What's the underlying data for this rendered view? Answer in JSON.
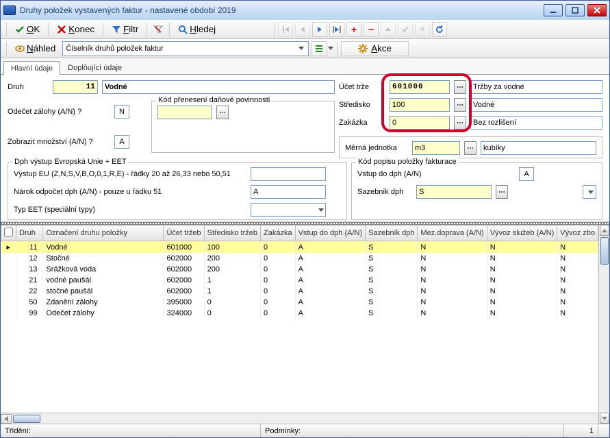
{
  "titlebar": {
    "title": "Druhy položek vystavených faktur - nastavené období 2019"
  },
  "toolbar1": {
    "ok": "OK",
    "konec": "Konec",
    "filtr": "Filtr",
    "hledej": "Hledej"
  },
  "toolbar2": {
    "nahled": "Náhled",
    "combo": "Číselník druhů položek faktur",
    "akce": "Akce"
  },
  "tabs": {
    "t1": "Hlavní údaje",
    "t2": "Doplňující údaje"
  },
  "form": {
    "druh_label": "Druh",
    "druh_code": "11",
    "druh_name": "Vodné",
    "odecet_label": "Odečet zálohy (A/N) ?",
    "odecet_val": "N",
    "zobrazit_label": "Zobrazit množství (A/N) ?",
    "zobrazit_val": "A",
    "kodpren_label": "Kód přenesení daňové povinnosti",
    "kodpren_val": "",
    "ucet_label": "Účet trže",
    "ucet_val": "601000",
    "ucet_desc": "Tržby za vodné",
    "stred_label": "Středisko",
    "stred_val": "100",
    "stred_desc": "Vodné",
    "zak_label": "Zakázka",
    "zak_val": "0",
    "zak_desc": "Bez rozlišení",
    "mj_label": "Měrná jednotka",
    "mj_val": "m3",
    "mj_desc": "kubíky",
    "eet_caption": "Dph výstup Evropská Unie + EET",
    "vystup_label": "Výstup EU (Z,N,S,V,B,O,0,1,R,E) - řádky 20 až 26,33 nebo 50,51",
    "vystup_val": "",
    "narok_label": "Nárok odpočet dph (A/N) - pouze u řádku 51",
    "narok_val": "A",
    "typeet_label": "Typ EET (speciální typy)",
    "typeet_val": "",
    "kodpop_caption": "Kód popisu položky fakturace",
    "vstup_label": "Vstup do dph (A/N)",
    "vstup_val": "A",
    "saz_label": "Sazebník dph",
    "saz_val": "S"
  },
  "grid": {
    "h0": "Druh",
    "h1": "Označení druhu položky",
    "h2": "Účet tržeb",
    "h3": "Středisko tržeb",
    "h4": "Zakázka",
    "h5": "Vstup do dph (A/N)",
    "h6": "Sazebník dph",
    "h7": "Mez.doprava (A/N)",
    "h8": "Vývoz služeb (A/N)",
    "h9": "Vývoz zbo",
    "rows": [
      {
        "c0": "11",
        "c1": "Vodné",
        "c2": "601000",
        "c3": "100",
        "c4": "0",
        "c5": "A",
        "c6": "S",
        "c7": "N",
        "c8": "N",
        "c9": "N"
      },
      {
        "c0": "12",
        "c1": "Stočné",
        "c2": "602000",
        "c3": "200",
        "c4": "0",
        "c5": "A",
        "c6": "S",
        "c7": "N",
        "c8": "N",
        "c9": "N"
      },
      {
        "c0": "13",
        "c1": "Srážková voda",
        "c2": "602000",
        "c3": "200",
        "c4": "0",
        "c5": "A",
        "c6": "S",
        "c7": "N",
        "c8": "N",
        "c9": "N"
      },
      {
        "c0": "21",
        "c1": "vodné paušál",
        "c2": "602000",
        "c3": "1",
        "c4": "0",
        "c5": "A",
        "c6": "S",
        "c7": "N",
        "c8": "N",
        "c9": "N"
      },
      {
        "c0": "22",
        "c1": "stočné paušál",
        "c2": "602000",
        "c3": "1",
        "c4": "0",
        "c5": "A",
        "c6": "S",
        "c7": "N",
        "c8": "N",
        "c9": "N"
      },
      {
        "c0": "50",
        "c1": "Zdanění zálohy",
        "c2": "395000",
        "c3": "0",
        "c4": "0",
        "c5": "A",
        "c6": "S",
        "c7": "N",
        "c8": "N",
        "c9": "N"
      },
      {
        "c0": "99",
        "c1": "Odečet zálohy",
        "c2": "324000",
        "c3": "0",
        "c4": "0",
        "c5": "A",
        "c6": "S",
        "c7": "N",
        "c8": "N",
        "c9": "N"
      }
    ]
  },
  "status": {
    "trideni": "Třídění:",
    "podminky": "Podmínky:",
    "count": "1"
  }
}
